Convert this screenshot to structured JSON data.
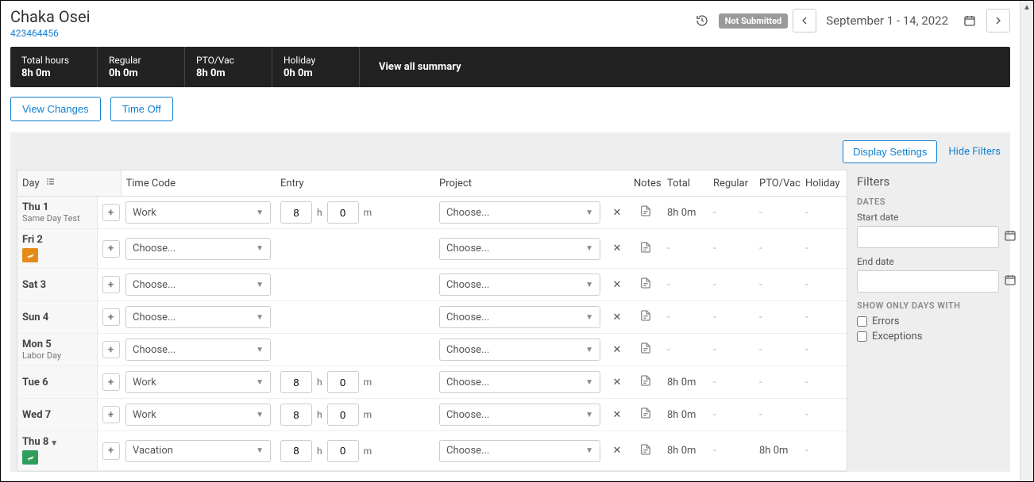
{
  "person": {
    "name": "Chaka Osei",
    "id": "423464456"
  },
  "header": {
    "status": "Not Submitted",
    "date_range": "September 1 - 14, 2022"
  },
  "summary": {
    "total": {
      "label": "Total hours",
      "value": "8h 0m"
    },
    "regular": {
      "label": "Regular",
      "value": "0h 0m"
    },
    "pto": {
      "label": "PTO/Vac",
      "value": "8h 0m"
    },
    "holiday": {
      "label": "Holiday",
      "value": "0h 0m"
    },
    "view_all": "View all summary"
  },
  "actions": {
    "view_changes": "View Changes",
    "time_off": "Time Off"
  },
  "toolbar": {
    "display_settings": "Display Settings",
    "hide_filters": "Hide Filters"
  },
  "table": {
    "headers": {
      "day": "Day",
      "time_code": "Time Code",
      "entry": "Entry",
      "project": "Project",
      "notes": "Notes",
      "total": "Total",
      "regular": "Regular",
      "pto": "PTO/Vac",
      "holiday": "Holiday"
    },
    "choose": "Choose...",
    "rows": [
      {
        "day": "Thu 1",
        "sub": "Same Day Test",
        "badge": "",
        "time_code": "Work",
        "hours": "8",
        "mins": "0",
        "project": "Choose...",
        "total": "8h 0m",
        "regular": "-",
        "pto": "-",
        "holiday": "-"
      },
      {
        "day": "Fri 2",
        "sub": "",
        "badge": "orange",
        "time_code": "Choose...",
        "hours": "",
        "mins": "",
        "project": "Choose...",
        "total": "-",
        "regular": "-",
        "pto": "-",
        "holiday": "-"
      },
      {
        "day": "Sat 3",
        "sub": "",
        "badge": "",
        "time_code": "Choose...",
        "hours": "",
        "mins": "",
        "project": "Choose...",
        "total": "-",
        "regular": "-",
        "pto": "-",
        "holiday": "-"
      },
      {
        "day": "Sun 4",
        "sub": "",
        "badge": "",
        "time_code": "Choose...",
        "hours": "",
        "mins": "",
        "project": "Choose...",
        "total": "-",
        "regular": "-",
        "pto": "-",
        "holiday": "-"
      },
      {
        "day": "Mon 5",
        "sub": "Labor Day",
        "badge": "",
        "time_code": "Choose...",
        "hours": "",
        "mins": "",
        "project": "Choose...",
        "total": "-",
        "regular": "-",
        "pto": "-",
        "holiday": "-"
      },
      {
        "day": "Tue 6",
        "sub": "",
        "badge": "",
        "time_code": "Work",
        "hours": "8",
        "mins": "0",
        "project": "Choose...",
        "total": "8h 0m",
        "regular": "-",
        "pto": "-",
        "holiday": "-"
      },
      {
        "day": "Wed 7",
        "sub": "",
        "badge": "",
        "time_code": "Work",
        "hours": "8",
        "mins": "0",
        "project": "Choose...",
        "total": "8h 0m",
        "regular": "-",
        "pto": "-",
        "holiday": "-"
      },
      {
        "day": "Thu 8",
        "sub": "",
        "badge": "green",
        "expand": true,
        "time_code": "Vacation",
        "hours": "8",
        "mins": "0",
        "project": "Choose...",
        "total": "8h 0m",
        "regular": "-",
        "pto": "8h 0m",
        "holiday": "-"
      }
    ]
  },
  "filters": {
    "title": "Filters",
    "dates_label": "DATES",
    "start": "Start date",
    "end": "End date",
    "show_only": "SHOW ONLY DAYS WITH",
    "errors": "Errors",
    "exceptions": "Exceptions"
  },
  "units": {
    "h": "h",
    "m": "m"
  }
}
